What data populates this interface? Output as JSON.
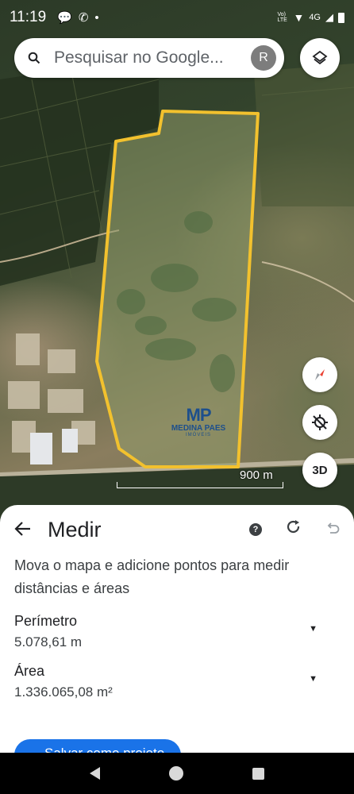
{
  "status_bar": {
    "time": "11:19",
    "network": "4G",
    "volte": "Vo) LTE"
  },
  "search": {
    "placeholder": "Pesquisar no Google...",
    "avatar_letter": "R"
  },
  "map": {
    "watermark_logo": "MP",
    "watermark_name": "MEDINA PAES",
    "watermark_sub": "IMÓVEIS",
    "scale_label": "900 m",
    "btn_3d": "3D",
    "outline_color": "#f2c12e"
  },
  "sheet": {
    "title": "Medir",
    "instructions": "Mova o mapa e adicione pontos para medir distâncias e áreas",
    "perimeter_label": "Perímetro",
    "perimeter_value": "5.078,61 m",
    "area_label": "Área",
    "area_value": "1.336.065,08 m²",
    "save_label": "Salvar como projeto"
  },
  "colors": {
    "accent": "#1a73e8"
  },
  "icons": [
    "search-icon",
    "layers-icon",
    "compass-icon",
    "location-off-icon",
    "back-arrow-icon",
    "help-icon",
    "redo-icon",
    "undo-icon",
    "dropdown-icon"
  ]
}
